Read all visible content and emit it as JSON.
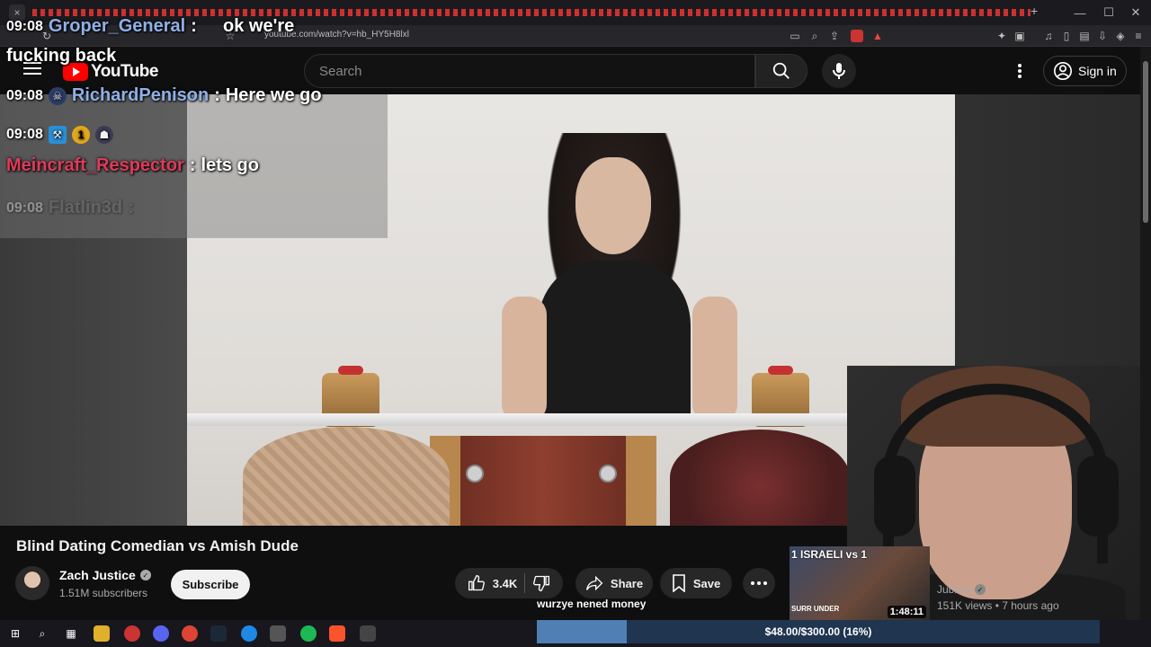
{
  "browser": {
    "url": "youtube.com/watch?v=hb_HY5H8lxl",
    "tab_close": "×",
    "new_tab": "+",
    "window_controls": [
      "—",
      "☐",
      "✕"
    ]
  },
  "youtube": {
    "logo_text": "YouTube",
    "search_placeholder": "Search",
    "sign_in": "Sign in"
  },
  "chat": [
    {
      "time": "09:08",
      "user": "Groper_General",
      "message": "ok we're fucking back",
      "color": "#8fb0e8"
    },
    {
      "time": "09:08",
      "user": "RichardPenison",
      "message": "Here we go",
      "color": "#8fb0e8"
    },
    {
      "time": "09:08",
      "user": "Meincraft_Respector",
      "message": "lets go",
      "color": "#e03a5a"
    },
    {
      "time": "09:08",
      "user": "Flatlin3d",
      "message": "",
      "color": "#777777"
    }
  ],
  "video": {
    "title": "Blind Dating Comedian vs Amish Dude",
    "channel": "Zach Justice",
    "subscribers": "1.51M subscribers",
    "subscribe_label": "Subscribe",
    "likes": "3.4K",
    "share_label": "Share",
    "save_label": "Save"
  },
  "donation_message": "wurzye nened money",
  "goal": {
    "text": "$48.00/$300.00 (16%)",
    "progress": 0.16
  },
  "recommendation": {
    "thumb_title": "1 ISRAELI vs 1",
    "thumb_sub": "SURR UNDER",
    "duration": "1:48:11",
    "channel": "Jubilee",
    "meta": "151K views • 7 hours ago"
  }
}
